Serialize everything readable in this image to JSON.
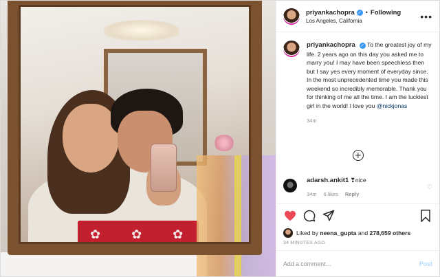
{
  "header": {
    "username": "priyankachopra",
    "follow_status": "Following",
    "location": "Los Angeles, California",
    "more_glyph": "•••"
  },
  "caption": {
    "username": "priyankachopra",
    "text": "To the greatest joy of my life. 2 years ago on this day you asked me to marry you! I may have been speechless then but I say yes every moment of everyday since. In the most unprecedented time you made this weekend so incredibly memorable. Thank you for thinking of me all the time. I am the luckiest girl in the world! I love you",
    "mention": "@nickjonas",
    "time": "34m"
  },
  "comments": [
    {
      "username": "adarsh.ankit1",
      "text": "❣nice",
      "time": "34m",
      "likes": "6 likes",
      "reply_label": "Reply"
    }
  ],
  "likes": {
    "prefix": "Liked by",
    "user": "neena_gupta",
    "conjunction": "and",
    "others": "278,659 others"
  },
  "posted_ago": "34 MINUTES AGO",
  "add_comment": {
    "placeholder": "Add a comment…",
    "post_label": "Post"
  },
  "icons": {
    "like": "heart-icon",
    "comment": "comment-icon",
    "share": "share-icon",
    "save": "bookmark-icon"
  },
  "colors": {
    "like_red": "#ed4956",
    "verified_blue": "#3897f0",
    "mention": "#00376b",
    "post_disabled": "#b3dbff"
  }
}
